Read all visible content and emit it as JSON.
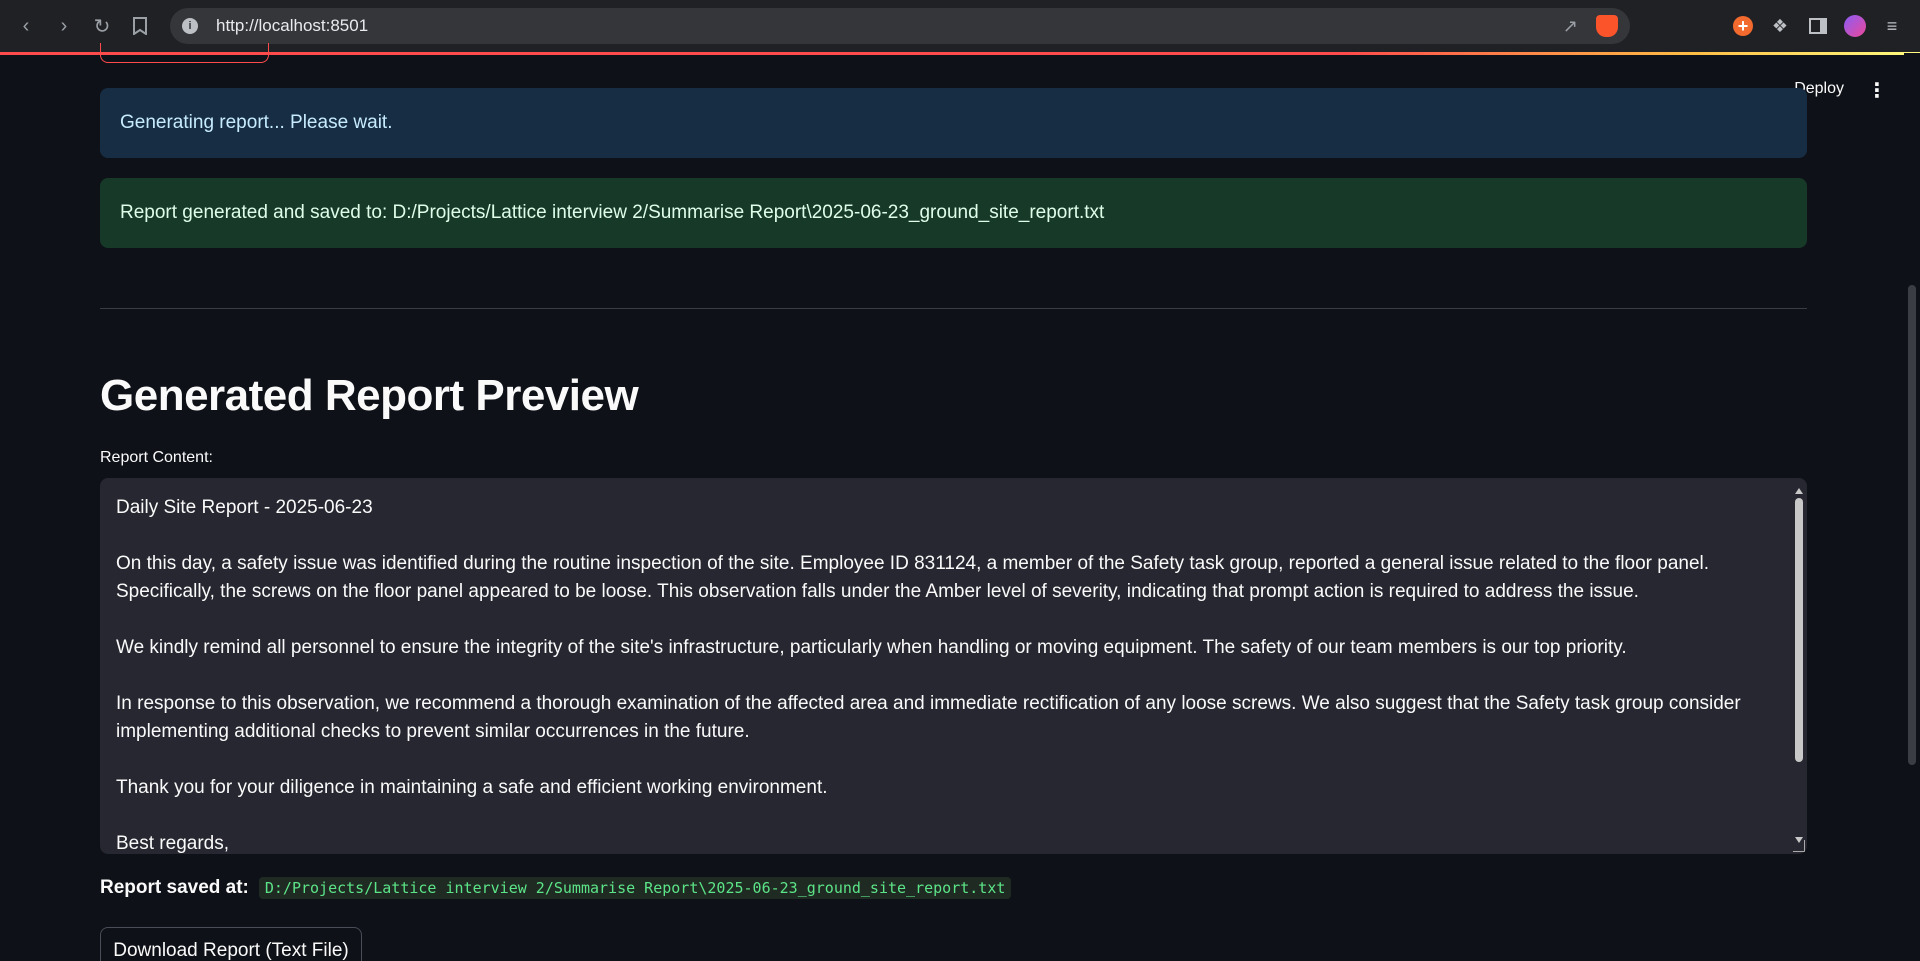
{
  "browser": {
    "url": "http://localhost:8501",
    "accent_colors": {
      "progress_start": "#ff4b4b",
      "progress_end": "#fffd80"
    }
  },
  "app_header": {
    "deploy_label": "Deploy"
  },
  "alerts": {
    "info": "Generating report... Please wait.",
    "success": "Report generated and saved to: D:/Projects/Lattice interview 2/Summarise Report\\2025-06-23_ground_site_report.txt"
  },
  "preview": {
    "heading": "Generated Report Preview",
    "textarea_label": "Report Content:",
    "paragraphs": [
      "Daily Site Report - 2025-06-23",
      "On this day, a safety issue was identified during the routine inspection of the site. Employee ID 831124, a member of the Safety task group, reported a general issue related to the floor panel. Specifically, the screws on the floor panel appeared to be loose. This observation falls under the Amber level of severity, indicating that prompt action is required to address the issue.",
      "We kindly remind all personnel to ensure the integrity of the site's infrastructure, particularly when handling or moving equipment. The safety of our team members is our top priority.",
      "In response to this observation, we recommend a thorough examination of the affected area and immediate rectification of any loose screws. We also suggest that the Safety task group consider implementing additional checks to prevent similar occurrences in the future.",
      "Thank you for your diligence in maintaining a safe and efficient working environment.",
      "Best regards,"
    ],
    "saved_at_label": "Report saved at:",
    "saved_at_path": "D:/Projects/Lattice interview 2/Summarise Report\\2025-06-23_ground_site_report.txt",
    "download_label": "Download Report (Text File)"
  },
  "icons": [
    "back-icon",
    "forward-icon",
    "reload-icon",
    "bookmark-icon",
    "info-icon",
    "share-icon",
    "brave-shield-icon",
    "extension-icon",
    "puzzle-icon",
    "sidebar-icon",
    "profile-icon",
    "menu-icon",
    "kebab-icon"
  ]
}
